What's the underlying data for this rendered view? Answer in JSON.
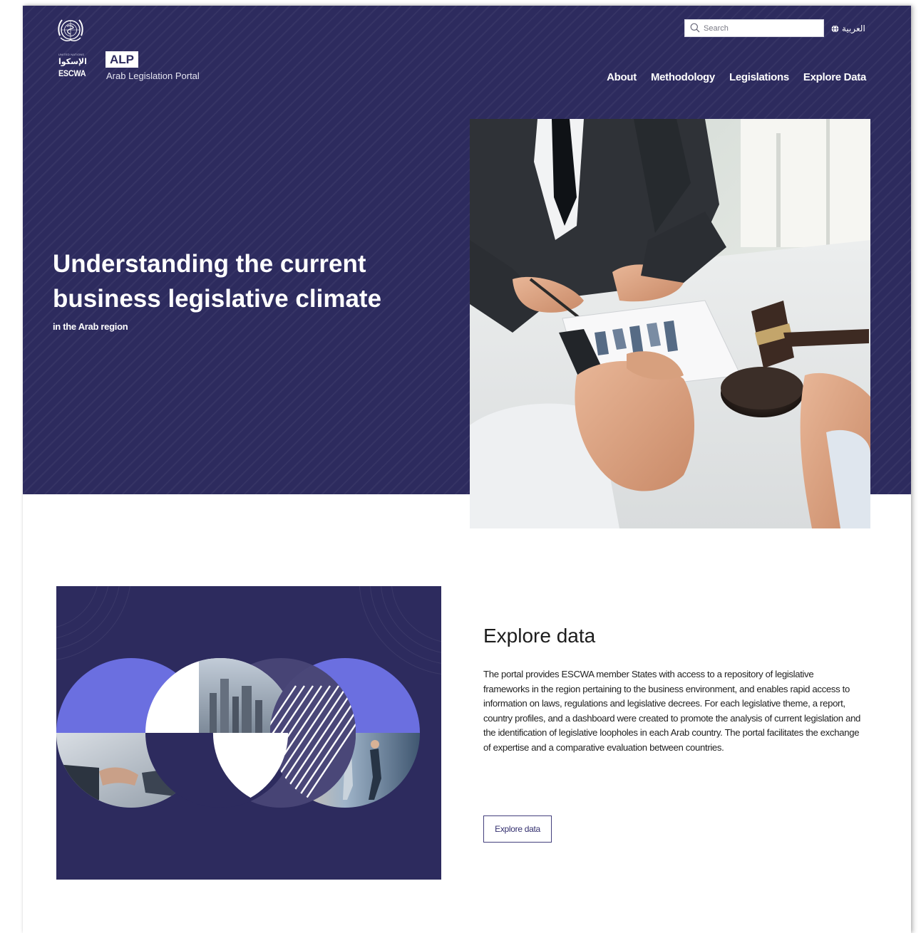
{
  "logo": {
    "un_small_text": "UNITED NATIONS",
    "arabic_name": "الإسكوا",
    "org_name": "ESCWA"
  },
  "brand": {
    "badge": "ALP",
    "subtitle": "Arab Legislation Portal"
  },
  "search": {
    "placeholder": "Search",
    "icon": "search-icon"
  },
  "language": {
    "label": "العربية",
    "icon": "globe-icon"
  },
  "nav": {
    "items": [
      {
        "label": "About"
      },
      {
        "label": "Methodology"
      },
      {
        "label": "Legislations"
      },
      {
        "label": "Explore Data"
      }
    ]
  },
  "hero": {
    "title": "Understanding the current business legislative climate",
    "subtitle": "in the Arab region"
  },
  "explore": {
    "title": "Explore data",
    "body": "The portal provides ESCWA member States with access to a repository of legislative frameworks in the region pertaining to the business environment, and enables rapid access to information on laws, regulations and legislative decrees. For each legislative theme, a report, country profiles, and a dashboard were created to promote the analysis of current legislation and the identification of legislative loopholes in each Arab country. The portal facilitates the exchange of expertise and a comparative evaluation between countries.",
    "button_label": "Explore data"
  },
  "colors": {
    "primary": "#2d2b5e",
    "accent": "#6b6fe0",
    "text": "#222222",
    "background": "#ffffff"
  }
}
